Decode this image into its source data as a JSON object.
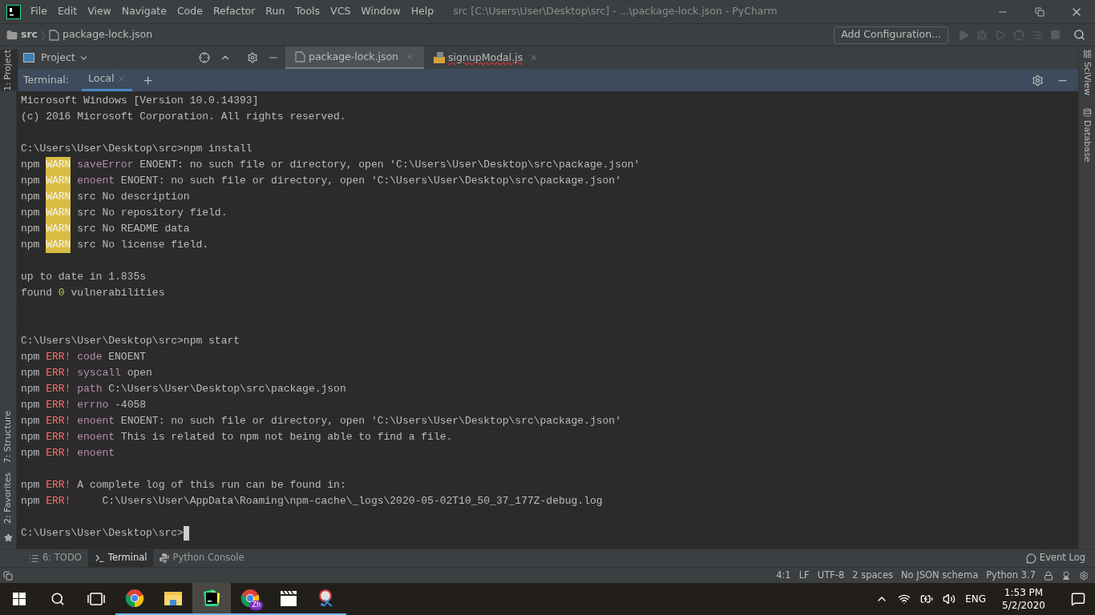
{
  "window": {
    "title": "src [C:\\Users\\User\\Desktop\\src] - ...\\package-lock.json - PyCharm",
    "menu": [
      "File",
      "Edit",
      "View",
      "Navigate",
      "Code",
      "Refactor",
      "Run",
      "Tools",
      "VCS",
      "Window",
      "Help"
    ]
  },
  "breadcrumbs": [
    "src",
    "package-lock.json"
  ],
  "run_config": "Add Configuration...",
  "left_stripe": {
    "top": "1: Project",
    "bottom": [
      "7: Structure",
      "2: Favorites"
    ]
  },
  "right_stripe": [
    "SciView",
    "Database"
  ],
  "project_panel": {
    "title": "Project"
  },
  "editor_tabs": [
    {
      "label": "package-lock.json",
      "kind": "json",
      "selected": true
    },
    {
      "label": "signupModal.js",
      "kind": "js",
      "selected": false
    }
  ],
  "terminal": {
    "title": "Terminal:",
    "tabs": [
      {
        "label": "Local",
        "selected": true
      }
    ],
    "lines": [
      {
        "kind": "text",
        "segments": [
          {
            "text": "Microsoft Windows [Version 10.0.14393]",
            "kind": "plain"
          }
        ]
      },
      {
        "kind": "text",
        "segments": [
          {
            "text": "(c) 2016 Microsoft Corporation. All rights reserved.",
            "kind": "plain"
          }
        ]
      },
      {
        "kind": "blank"
      },
      {
        "kind": "text",
        "segments": [
          {
            "text": "C:\\Users\\User\\Desktop\\src>npm install",
            "kind": "plain"
          }
        ]
      },
      {
        "kind": "text",
        "segments": [
          {
            "text": "npm ",
            "kind": "plain"
          },
          {
            "text": "WARN",
            "kind": "warn"
          },
          {
            "text": " saveError",
            "kind": "keyword"
          },
          {
            "text": " ENOENT: no such file or directory, open 'C:\\Users\\User\\Desktop\\src\\package.json'",
            "kind": "plain"
          }
        ]
      },
      {
        "kind": "text",
        "segments": [
          {
            "text": "npm ",
            "kind": "plain"
          },
          {
            "text": "WARN",
            "kind": "warn"
          },
          {
            "text": " enoent",
            "kind": "keyword"
          },
          {
            "text": " ENOENT: no such file or directory, open 'C:\\Users\\User\\Desktop\\src\\package.json'",
            "kind": "plain"
          }
        ]
      },
      {
        "kind": "text",
        "segments": [
          {
            "text": "npm ",
            "kind": "plain"
          },
          {
            "text": "WARN",
            "kind": "warn"
          },
          {
            "text": " src No description",
            "kind": "plain"
          }
        ]
      },
      {
        "kind": "text",
        "segments": [
          {
            "text": "npm ",
            "kind": "plain"
          },
          {
            "text": "WARN",
            "kind": "warn"
          },
          {
            "text": " src No repository field.",
            "kind": "plain"
          }
        ]
      },
      {
        "kind": "text",
        "segments": [
          {
            "text": "npm ",
            "kind": "plain"
          },
          {
            "text": "WARN",
            "kind": "warn"
          },
          {
            "text": " src No README data",
            "kind": "plain"
          }
        ]
      },
      {
        "kind": "text",
        "segments": [
          {
            "text": "npm ",
            "kind": "plain"
          },
          {
            "text": "WARN",
            "kind": "warn"
          },
          {
            "text": " src No license field.",
            "kind": "plain"
          }
        ]
      },
      {
        "kind": "blank"
      },
      {
        "kind": "text",
        "segments": [
          {
            "text": "up to date in 1.835s",
            "kind": "plain"
          }
        ]
      },
      {
        "kind": "text",
        "segments": [
          {
            "text": "found ",
            "kind": "plain"
          },
          {
            "text": "0",
            "kind": "number"
          },
          {
            "text": " vulnerabilities",
            "kind": "plain"
          }
        ]
      },
      {
        "kind": "blank"
      },
      {
        "kind": "blank"
      },
      {
        "kind": "text",
        "segments": [
          {
            "text": "C:\\Users\\User\\Desktop\\src>npm start",
            "kind": "plain"
          }
        ]
      },
      {
        "kind": "text",
        "segments": [
          {
            "text": "npm ",
            "kind": "plain"
          },
          {
            "text": "ERR!",
            "kind": "err"
          },
          {
            "text": " code",
            "kind": "keyword"
          },
          {
            "text": " ENOENT",
            "kind": "plain"
          }
        ]
      },
      {
        "kind": "text",
        "segments": [
          {
            "text": "npm ",
            "kind": "plain"
          },
          {
            "text": "ERR!",
            "kind": "err"
          },
          {
            "text": " syscall",
            "kind": "keyword"
          },
          {
            "text": " open",
            "kind": "plain"
          }
        ]
      },
      {
        "kind": "text",
        "segments": [
          {
            "text": "npm ",
            "kind": "plain"
          },
          {
            "text": "ERR!",
            "kind": "err"
          },
          {
            "text": " path",
            "kind": "keyword"
          },
          {
            "text": " C:\\Users\\User\\Desktop\\src\\package.json",
            "kind": "plain"
          }
        ]
      },
      {
        "kind": "text",
        "segments": [
          {
            "text": "npm ",
            "kind": "plain"
          },
          {
            "text": "ERR!",
            "kind": "err"
          },
          {
            "text": " errno",
            "kind": "keyword"
          },
          {
            "text": " -4058",
            "kind": "plain"
          }
        ]
      },
      {
        "kind": "text",
        "segments": [
          {
            "text": "npm ",
            "kind": "plain"
          },
          {
            "text": "ERR!",
            "kind": "err"
          },
          {
            "text": " enoent",
            "kind": "keyword"
          },
          {
            "text": " ENOENT: no such file or directory, open 'C:\\Users\\User\\Desktop\\src\\package.json'",
            "kind": "plain"
          }
        ]
      },
      {
        "kind": "text",
        "segments": [
          {
            "text": "npm ",
            "kind": "plain"
          },
          {
            "text": "ERR!",
            "kind": "err"
          },
          {
            "text": " enoent",
            "kind": "keyword"
          },
          {
            "text": " This is related to npm not being able to find a file.",
            "kind": "plain"
          }
        ]
      },
      {
        "kind": "text",
        "segments": [
          {
            "text": "npm ",
            "kind": "plain"
          },
          {
            "text": "ERR!",
            "kind": "err"
          },
          {
            "text": " enoent",
            "kind": "keyword"
          }
        ]
      },
      {
        "kind": "blank"
      },
      {
        "kind": "text",
        "segments": [
          {
            "text": "npm ",
            "kind": "plain"
          },
          {
            "text": "ERR!",
            "kind": "err"
          },
          {
            "text": " A complete log of this run can be found in:",
            "kind": "plain"
          }
        ]
      },
      {
        "kind": "text",
        "segments": [
          {
            "text": "npm ",
            "kind": "plain"
          },
          {
            "text": "ERR!",
            "kind": "err"
          },
          {
            "text": "     C:\\Users\\User\\AppData\\Roaming\\npm-cache\\_logs\\2020-05-02T10_50_37_177Z-debug.log",
            "kind": "plain"
          }
        ]
      },
      {
        "kind": "blank"
      },
      {
        "kind": "text",
        "segments": [
          {
            "text": "C:\\Users\\User\\Desktop\\src>",
            "kind": "plain"
          }
        ],
        "cursor": true
      }
    ]
  },
  "tool_windows": [
    {
      "label": "6: TODO",
      "kind": "todo",
      "selected": false
    },
    {
      "label": "Terminal",
      "kind": "terminal",
      "selected": true
    },
    {
      "label": "Python Console",
      "kind": "python",
      "selected": false
    }
  ],
  "event_log": "Event Log",
  "status_bar": [
    "4:1",
    "LF",
    "UTF-8",
    "2 spaces",
    "No JSON schema",
    "Python 3.7"
  ],
  "taskbar": {
    "apps": [
      {
        "kind": "chrome",
        "selected": false
      },
      {
        "kind": "explorer",
        "selected": false
      },
      {
        "kind": "pycharm",
        "selected": true
      },
      {
        "kind": "chrome-profile",
        "badge": "Zh",
        "selected": false
      },
      {
        "kind": "clapper",
        "selected": false
      },
      {
        "kind": "snip",
        "selected": false
      }
    ],
    "language": "ENG",
    "time": "1:53 PM",
    "date": "5/2/2020"
  }
}
